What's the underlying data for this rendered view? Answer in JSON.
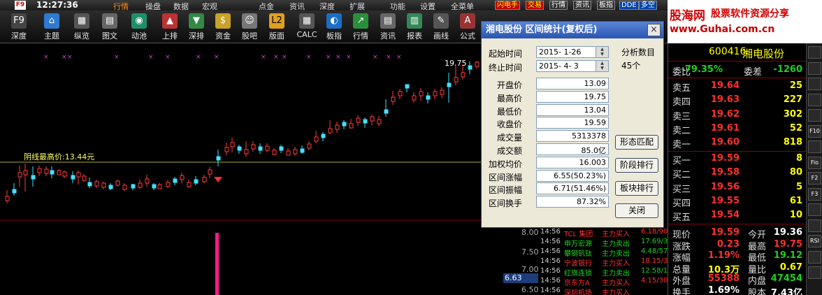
{
  "menubar": {
    "clock": "12:27:36",
    "items": [
      "行情",
      "操盘",
      "数据",
      "宏观",
      "点金",
      "资讯",
      "深度",
      "扩展",
      "功能",
      "设置",
      "全菜单"
    ],
    "tags": [
      "闪电手",
      "交易",
      "行情",
      "资讯",
      "板指",
      "DDE",
      "多空"
    ],
    "f9": "F9"
  },
  "toolbar": {
    "buttons": [
      "深度",
      "主题",
      "纵览",
      "图文",
      "动池",
      "上排",
      "深排",
      "资金",
      "股吧",
      "版面",
      "CALC",
      "板指",
      "行情",
      "资讯",
      "报表",
      "画线",
      "公式"
    ]
  },
  "brand": {
    "name": "股海网",
    "slogan": "股票软件资源分享",
    "url": "www.Guhai.com.cn"
  },
  "chart": {
    "annotation": "阴线最高价:13.44元",
    "high_label": "19.75",
    "axis_labels": [
      "8.00",
      "7.50",
      "7.00",
      "6.63",
      "6.50"
    ]
  },
  "dialog": {
    "title": "湘电股份  区间统计(复权后)",
    "close": "×",
    "start_label": "起始时间",
    "start_value": "2015- 1-26",
    "end_label": "终止时间",
    "end_value": "2015- 4- 3",
    "stats": [
      {
        "label": "开盘价",
        "value": "13.09"
      },
      {
        "label": "最高价",
        "value": "19.75"
      },
      {
        "label": "最低价",
        "value": "13.04"
      },
      {
        "label": "收盘价",
        "value": "19.59"
      },
      {
        "label": "成交量",
        "value": "5313378"
      },
      {
        "label": "成交额",
        "value": "85.0亿"
      },
      {
        "label": "加权均价",
        "value": "16.003"
      },
      {
        "label": "区间涨幅",
        "value": "6.55(50.23%)"
      },
      {
        "label": "区间振幅",
        "value": "6.71(51.46%)"
      },
      {
        "label": "区间换手",
        "value": "87.32%"
      }
    ],
    "analysis_label": "分析数目",
    "analysis_count": "45个",
    "buttons": {
      "pattern": "形态匹配",
      "stage": "阶段排行",
      "sector": "板块排行",
      "close": "关闭"
    }
  },
  "ticks": [
    {
      "time": "14:56",
      "name": "TCL 集团",
      "action": "主力买入",
      "price": "6.18/90",
      "color": "#ff3030"
    },
    {
      "time": "14:56",
      "name": "申万宏源",
      "action": "主力卖出",
      "price": "17.69/3",
      "color": "#20d020"
    },
    {
      "time": "14:56",
      "name": "攀钢钒钛",
      "action": "主力卖出",
      "price": "4.48/57",
      "color": "#20d020"
    },
    {
      "time": "14:56",
      "name": "宁波银行",
      "action": "主力买入",
      "price": "18.15/3",
      "color": "#ff3030"
    },
    {
      "time": "14:56",
      "name": "红旗连锁",
      "action": "主力卖出",
      "price": "12.58/1",
      "color": "#20d020"
    },
    {
      "time": "14:56",
      "name": "京东方A",
      "action": "主力买入",
      "price": "4.15/30",
      "color": "#ff3030"
    },
    {
      "time": "14:56",
      "name": "深圳机场",
      "action": "主力买入",
      "price": "",
      "color": "#ff3030"
    }
  ],
  "quote": {
    "code": "600416",
    "name": "湘电股份",
    "weibi_label": "委比",
    "weibi": "-79.35%",
    "weicha_label": "委差",
    "weicha": "-1260",
    "sells": [
      {
        "label": "卖五",
        "price": "19.64",
        "vol": "25"
      },
      {
        "label": "卖四",
        "price": "19.63",
        "vol": "227"
      },
      {
        "label": "卖三",
        "price": "19.62",
        "vol": "302"
      },
      {
        "label": "卖二",
        "price": "19.61",
        "vol": "52"
      },
      {
        "label": "卖一",
        "price": "19.60",
        "vol": "818"
      }
    ],
    "buys": [
      {
        "label": "买一",
        "price": "19.59",
        "vol": "8"
      },
      {
        "label": "买二",
        "price": "19.58",
        "vol": "80"
      },
      {
        "label": "买三",
        "price": "19.56",
        "vol": "5"
      },
      {
        "label": "买四",
        "price": "19.55",
        "vol": "61"
      },
      {
        "label": "买五",
        "price": "19.54",
        "vol": "10"
      }
    ],
    "stats": [
      {
        "l": "现价",
        "v": "19.59",
        "l2": "今开",
        "w": "19.36",
        "vc": "#ff3030",
        "wc": "#ffffff"
      },
      {
        "l": "涨跌",
        "v": "0.23",
        "l2": "最高",
        "w": "19.75",
        "vc": "#ff3030",
        "wc": "#ff3030"
      },
      {
        "l": "涨幅",
        "v": "1.19%",
        "l2": "最低",
        "w": "19.12",
        "vc": "#ff3030",
        "wc": "#20d020"
      },
      {
        "l": "总量",
        "v": "10.3万",
        "l2": "量比",
        "w": "0.67",
        "vc": "#ffff00",
        "wc": "#ffff00"
      },
      {
        "l": "外盘",
        "v": "55388",
        "l2": "内盘",
        "w": "47454",
        "vc": "#ff3030",
        "wc": "#20d020"
      },
      {
        "l": "换手",
        "v": "1.69%",
        "l2": "股本",
        "w": "7.43亿",
        "vc": "#ffffff",
        "wc": "#ffffff"
      }
    ]
  },
  "side_icons": [
    "chart-icon",
    "line-icon",
    "kline-icon",
    "grid-icon",
    "flame-icon",
    "f10-icon",
    "info-icon",
    "fi-icon",
    "f2-icon",
    "f3-icon",
    "up-icon",
    "dn-icon",
    "rsi-icon",
    "swap-icon",
    "cross-icon"
  ],
  "side_labels": [
    "",
    "",
    "",
    "",
    "",
    "F10",
    "",
    "Fio",
    "F2",
    "F3",
    "",
    "",
    "RSI",
    "",
    ""
  ]
}
